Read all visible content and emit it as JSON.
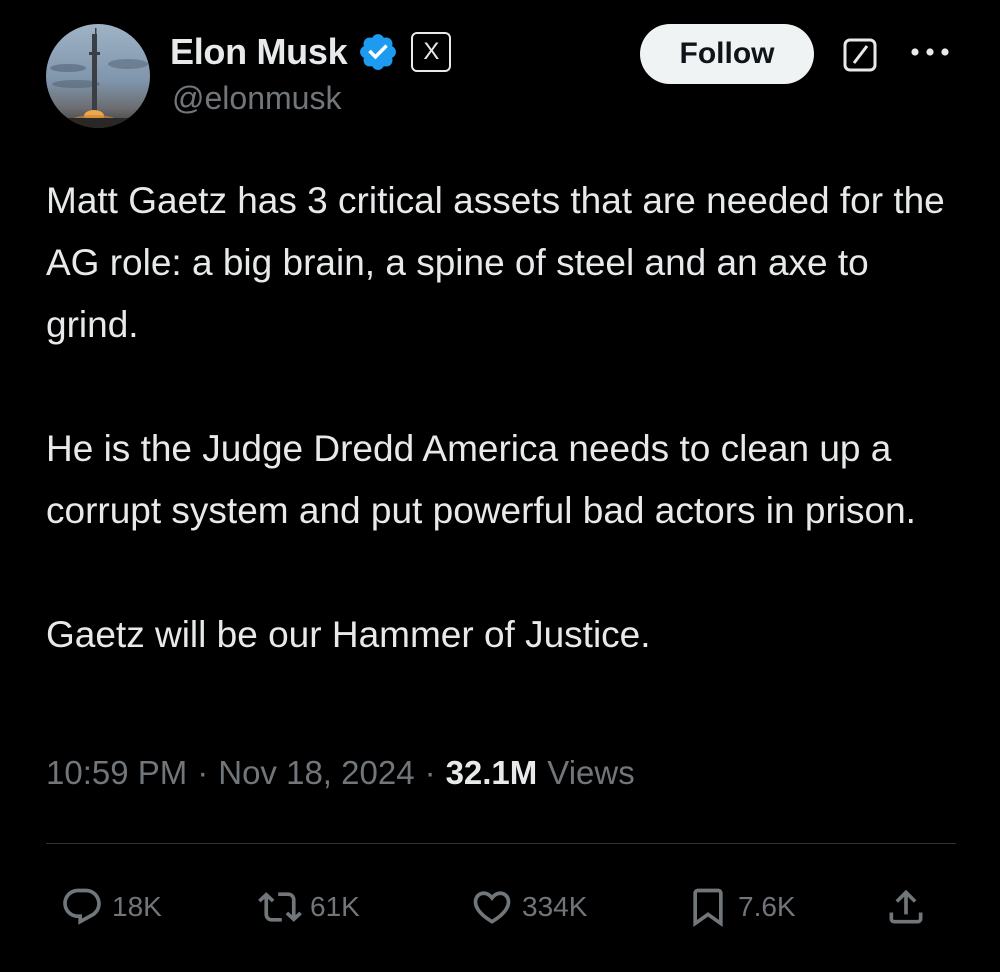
{
  "author": {
    "display_name": "Elon Musk",
    "handle": "@elonmusk",
    "x_badge": "X"
  },
  "header": {
    "follow_label": "Follow",
    "grok_icon": "grok-icon",
    "more_icon": "more-icon"
  },
  "tweet": {
    "paragraphs": [
      "Matt Gaetz has 3 critical assets that are needed for the AG role: a big brain, a spine of steel and an axe to grind.",
      "He is the Judge Dredd America needs to clean up a corrupt system and put powerful bad actors in prison.",
      "Gaetz will be our Hammer of Justice."
    ],
    "time": "10:59 PM",
    "separator": "·",
    "date": "Nov 18, 2024",
    "views_count": "32.1M",
    "views_label": "Views"
  },
  "actions": {
    "replies": "18K",
    "reposts": "61K",
    "likes": "334K",
    "bookmarks": "7.6K"
  },
  "colors": {
    "background": "#000000",
    "text": "#e7e9ea",
    "muted": "#71767b",
    "verified": "#1d9bf0",
    "follow_bg": "#eff3f4"
  }
}
